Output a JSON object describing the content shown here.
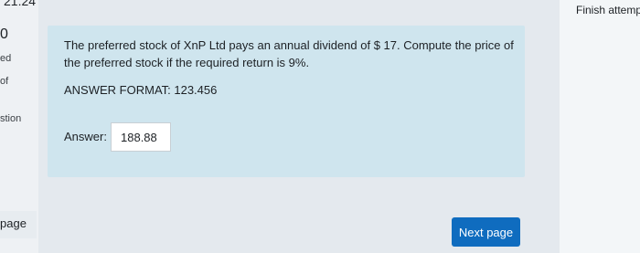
{
  "nav": {
    "timer": "21:24",
    "question_number": "0",
    "status_fragment": "ed",
    "marks_fragment": "of",
    "flag_fragment": "stion",
    "prev_page_fragment": "page",
    "finish_attempt": "Finish attemp"
  },
  "question": {
    "text": "The preferred stock of XnP Ltd pays an annual dividend of $ 17. Compute the price of the preferred stock if the required return is 9%.",
    "answer_format": "ANSWER FORMAT: 123.456",
    "answer_label": "Answer:",
    "answer_value": "188.88"
  },
  "buttons": {
    "next_page": "Next page"
  },
  "colors": {
    "question_background": "#cfe5ee",
    "primary_button": "#0f6cbf"
  }
}
